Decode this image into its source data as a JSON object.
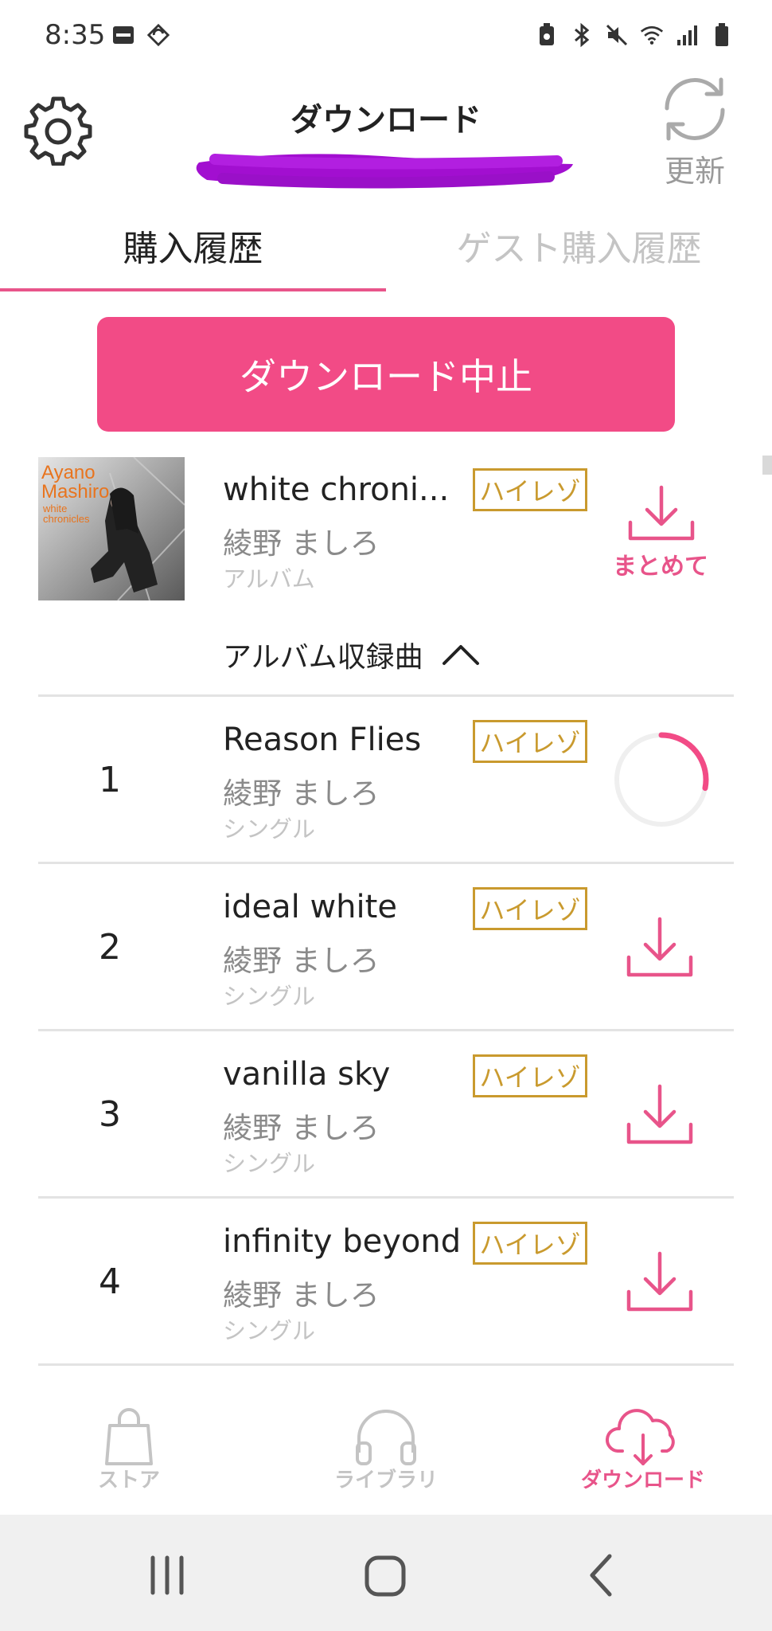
{
  "status_bar": {
    "time": "8:35"
  },
  "header": {
    "title": "ダウンロード",
    "refresh_label": "更新"
  },
  "tabs": [
    {
      "label": "購入履歴",
      "active": true
    },
    {
      "label": "ゲスト購入履歴",
      "active": false
    }
  ],
  "stop_button": {
    "label": "ダウンロード中止"
  },
  "album": {
    "cover_text_line1": "Ayano",
    "cover_text_line2": "Mashiro",
    "cover_text_line3": "white",
    "cover_text_line4": "chronicles",
    "title": "white chroni...",
    "badge": "ハイレゾ",
    "artist": "綾野 ましろ",
    "type": "アルバム",
    "bulk_download_label": "まとめて"
  },
  "tracks_toggle": {
    "label": "アルバム収録曲"
  },
  "tracks": [
    {
      "number": "1",
      "title": "Reason Flies",
      "badge": "ハイレゾ",
      "artist": "綾野 ましろ",
      "type": "シングル",
      "status": "downloading",
      "progress": 0.28
    },
    {
      "number": "2",
      "title": "ideal white",
      "badge": "ハイレゾ",
      "artist": "綾野 ましろ",
      "type": "シングル",
      "status": "ready"
    },
    {
      "number": "3",
      "title": "vanilla sky",
      "badge": "ハイレゾ",
      "artist": "綾野 ましろ",
      "type": "シングル",
      "status": "ready"
    },
    {
      "number": "4",
      "title": "infinity beyond",
      "badge": "ハイレゾ",
      "artist": "綾野 ましろ",
      "type": "シングル",
      "status": "ready"
    }
  ],
  "bottom_nav": [
    {
      "label": "ストア",
      "active": false
    },
    {
      "label": "ライブラリ",
      "active": false
    },
    {
      "label": "ダウンロード",
      "active": true
    }
  ],
  "colors": {
    "accent": "#f24b86",
    "accent_text": "#e8548a",
    "badge": "#c99a2e",
    "inactive": "#c4c4c4"
  }
}
